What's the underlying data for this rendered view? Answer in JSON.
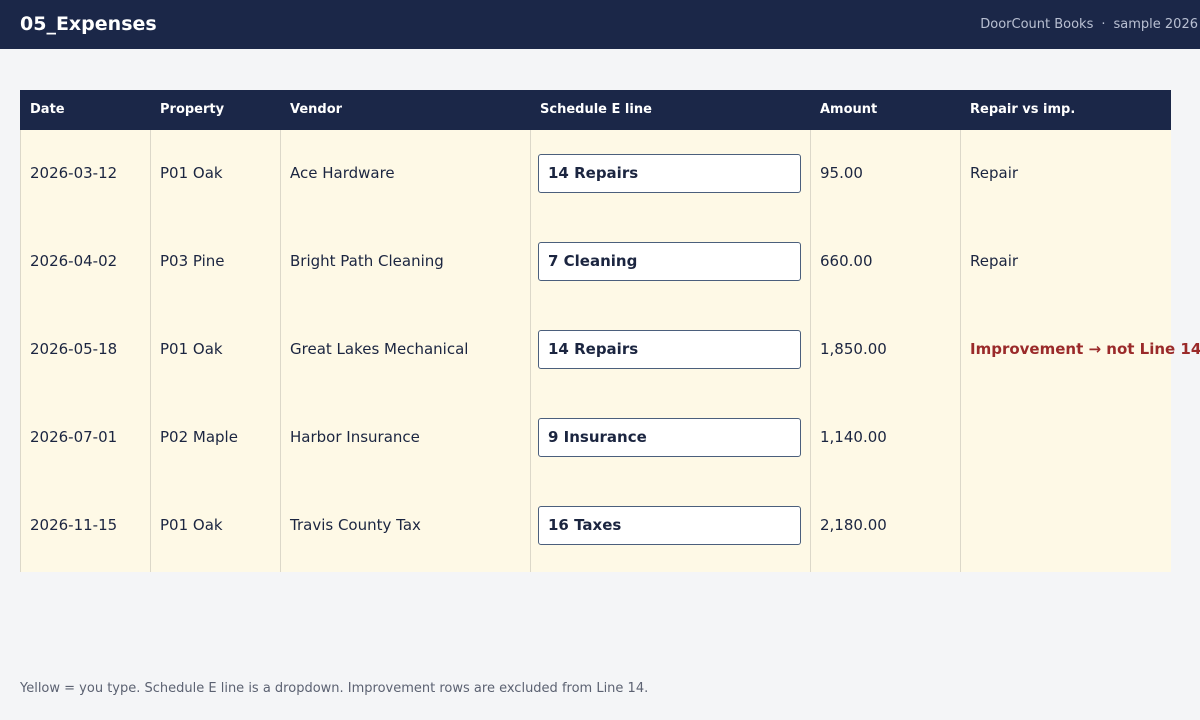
{
  "sheet": {
    "title": "05_Expenses",
    "app_name": "DoorCount Books",
    "separator": "·",
    "dataset": "sample 2026"
  },
  "columns": {
    "date": "Date",
    "property": "Property",
    "vendor": "Vendor",
    "schedule_e_line": "Schedule E line",
    "amount": "Amount",
    "repair_vs_imp": "Repair vs imp."
  },
  "rows": [
    {
      "date": "2026-03-12",
      "property": "P01 Oak",
      "vendor": "Ace Hardware",
      "schedule_e_line": "14 Repairs",
      "amount": "95.00",
      "classification": "Repair",
      "flag": ""
    },
    {
      "date": "2026-04-02",
      "property": "P03 Pine",
      "vendor": "Bright Path Cleaning",
      "schedule_e_line": "7 Cleaning",
      "amount": "660.00",
      "classification": "Repair",
      "flag": ""
    },
    {
      "date": "2026-05-18",
      "property": "P01 Oak",
      "vendor": "Great Lakes Mechanical",
      "schedule_e_line": "14 Repairs",
      "amount": "1,850.00",
      "classification": "",
      "flag": "Improvement  → not Line 14"
    },
    {
      "date": "2026-07-01",
      "property": "P02 Maple",
      "vendor": "Harbor Insurance",
      "schedule_e_line": "9 Insurance",
      "amount": "1,140.00",
      "classification": "",
      "flag": ""
    },
    {
      "date": "2026-11-15",
      "property": "P01 Oak",
      "vendor": "Travis County Tax",
      "schedule_e_line": "16 Taxes",
      "amount": "2,180.00",
      "classification": "",
      "flag": ""
    }
  ],
  "footnote": "Yellow = you type. Schedule E line is a dropdown. Improvement rows are excluded from Line 14.",
  "colors": {
    "header_bg": "#1b2748",
    "input_cell_bg": "#fef9e6",
    "flag_text": "#9a2a2a"
  }
}
